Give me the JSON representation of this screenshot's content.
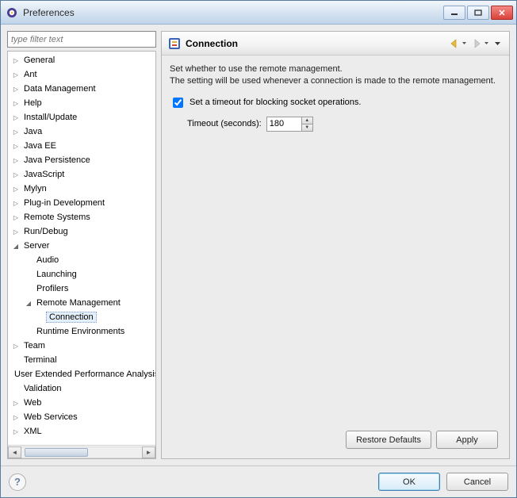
{
  "window": {
    "title": "Preferences"
  },
  "filter": {
    "placeholder": "type filter text"
  },
  "tree": [
    {
      "label": "General",
      "depth": 0,
      "tw": "▷"
    },
    {
      "label": "Ant",
      "depth": 0,
      "tw": "▷"
    },
    {
      "label": "Data Management",
      "depth": 0,
      "tw": "▷"
    },
    {
      "label": "Help",
      "depth": 0,
      "tw": "▷"
    },
    {
      "label": "Install/Update",
      "depth": 0,
      "tw": "▷"
    },
    {
      "label": "Java",
      "depth": 0,
      "tw": "▷"
    },
    {
      "label": "Java EE",
      "depth": 0,
      "tw": "▷"
    },
    {
      "label": "Java Persistence",
      "depth": 0,
      "tw": "▷"
    },
    {
      "label": "JavaScript",
      "depth": 0,
      "tw": "▷"
    },
    {
      "label": "Mylyn",
      "depth": 0,
      "tw": "▷"
    },
    {
      "label": "Plug-in Development",
      "depth": 0,
      "tw": "▷"
    },
    {
      "label": "Remote Systems",
      "depth": 0,
      "tw": "▷"
    },
    {
      "label": "Run/Debug",
      "depth": 0,
      "tw": "▷"
    },
    {
      "label": "Server",
      "depth": 0,
      "tw": "◢"
    },
    {
      "label": "Audio",
      "depth": 1,
      "tw": ""
    },
    {
      "label": "Launching",
      "depth": 1,
      "tw": ""
    },
    {
      "label": "Profilers",
      "depth": 1,
      "tw": ""
    },
    {
      "label": "Remote Management",
      "depth": 1,
      "tw": "◢"
    },
    {
      "label": "Connection",
      "depth": 2,
      "tw": "",
      "selected": true
    },
    {
      "label": "Runtime Environments",
      "depth": 1,
      "tw": ""
    },
    {
      "label": "Team",
      "depth": 0,
      "tw": "▷"
    },
    {
      "label": "Terminal",
      "depth": 0,
      "tw": ""
    },
    {
      "label": "User Extended Performance Analysis",
      "depth": 0,
      "tw": ""
    },
    {
      "label": "Validation",
      "depth": 0,
      "tw": ""
    },
    {
      "label": "Web",
      "depth": 0,
      "tw": "▷"
    },
    {
      "label": "Web Services",
      "depth": 0,
      "tw": "▷"
    },
    {
      "label": "XML",
      "depth": 0,
      "tw": "▷"
    }
  ],
  "page": {
    "icon": "connection-page-icon",
    "title": "Connection",
    "description_line1": "Set whether to use the remote management.",
    "description_line2": "The setting will be used whenever a connection is made to the remote management.",
    "checkbox_label": "Set a timeout for blocking socket operations.",
    "checkbox_checked": true,
    "timeout_label": "Timeout (seconds):",
    "timeout_value": "180"
  },
  "buttons": {
    "restore": "Restore Defaults",
    "apply": "Apply",
    "ok": "OK",
    "cancel": "Cancel"
  }
}
